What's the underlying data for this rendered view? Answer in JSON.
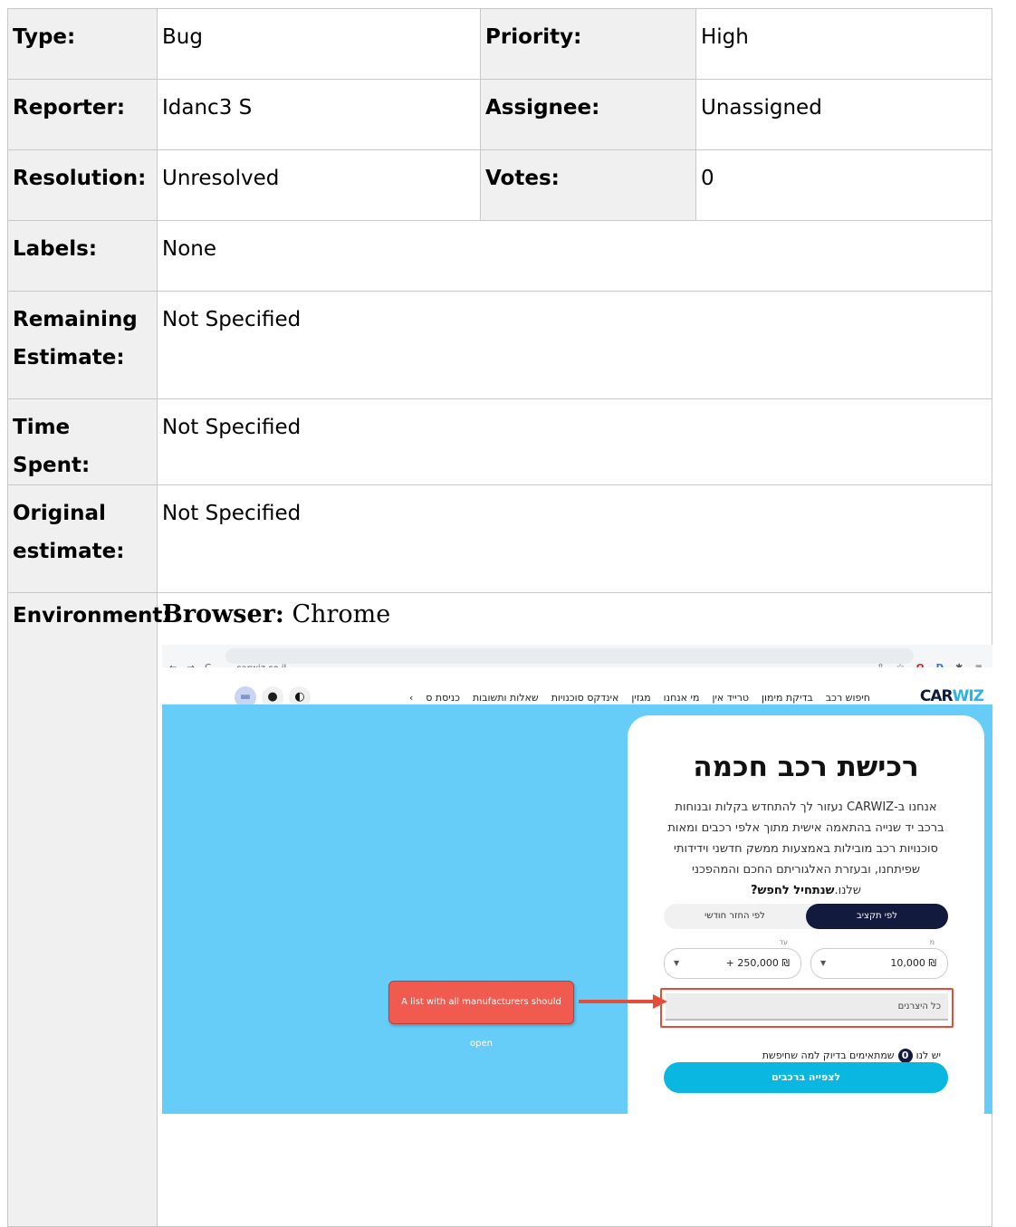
{
  "fields": {
    "type": {
      "label": "Type:",
      "value": "Bug"
    },
    "priority": {
      "label": "Priority:",
      "value": "High"
    },
    "reporter": {
      "label": "Reporter:",
      "value": "Idanc3 S"
    },
    "assignee": {
      "label": "Assignee:",
      "value": "Unassigned"
    },
    "resolution": {
      "label": "Resolution:",
      "value": "Unresolved"
    },
    "votes": {
      "label": "Votes:",
      "value": "0"
    },
    "labels": {
      "label": "Labels:",
      "value": "None"
    },
    "remaining_estimate": {
      "label": "Remaining Estimate:",
      "value": "Not Specified"
    },
    "time_spent": {
      "label": "Time Spent:",
      "value": "Not Specified"
    },
    "original_estimate": {
      "label": "Original estimate:",
      "value": "Not Specified"
    },
    "environment": {
      "label": "Environment:",
      "browser_label": "Browser:",
      "browser_value": "Chrome"
    }
  },
  "screenshot": {
    "url": "carwiz.co.il",
    "logo_a": "CAR",
    "logo_b": "WIZ",
    "menu": [
      "חיפוש רכב",
      "בדיקת מימון",
      "טרייד אין",
      "מי אנחנו",
      "מגזין",
      "אינדקס סוכנויות",
      "שאלות ותשובות",
      "כניסת ס"
    ],
    "menu_chevron": "›",
    "title": "רכישת רכב חכמה",
    "desc_text": "אנחנו ב-CARWIZ נעזור לך להתחדש בקלות ובנוחות ברכב יד שנייה בהתאמה אישית מתוך אלפי רכבים ומאות סוכנויות רכב מובילות באמצעות ממשק חדשני וידידותי שפיתחנו, ובעזרת האלגוריתם החכם והמהפכני שלנו.",
    "desc_bold": "שנתחיל לחפש?",
    "tab_budget": "לפי תקציב",
    "tab_monthly": "לפי החזר חודשי",
    "from_caption": "מ",
    "from_value": "₪ 10,000",
    "to_caption": "עד",
    "to_value": "₪ 250,000 +",
    "manufacturers_placeholder": "כל היצרנים",
    "count_prefix": "יש לנו",
    "count_value": "0",
    "count_suffix": "שמתאימים בדיוק למה שחיפשת",
    "cta_label": "לצפייה ברכבים",
    "callout_text": "A list with all manufacturers should open"
  }
}
